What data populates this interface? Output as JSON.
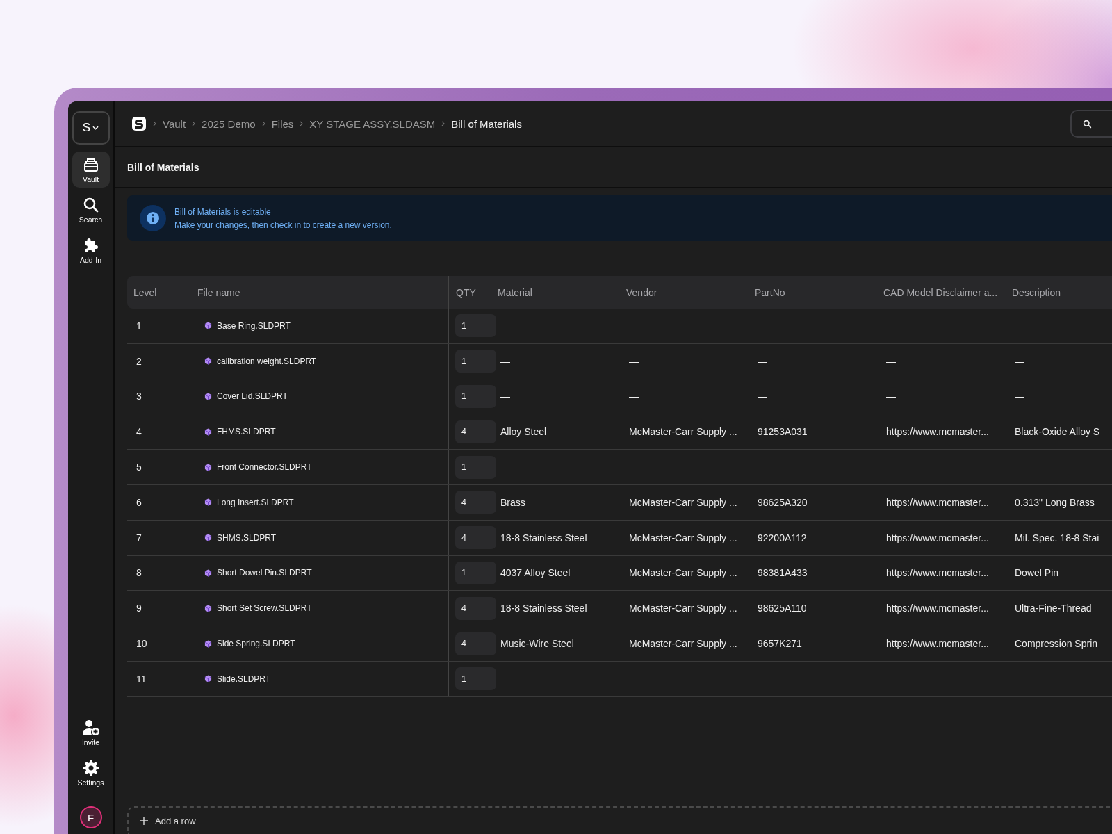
{
  "sidebar": {
    "workspace_button": "S",
    "nav": [
      {
        "label": "Vault",
        "selected": true
      },
      {
        "label": "Search",
        "selected": false
      },
      {
        "label": "Add-In",
        "selected": false
      }
    ],
    "bottom": [
      {
        "label": "Invite"
      },
      {
        "label": "Settings"
      }
    ],
    "avatar": "F"
  },
  "breadcrumb": [
    "Vault",
    "2025 Demo",
    "Files",
    "XY STAGE ASSY.SLDASM",
    "Bill of Materials"
  ],
  "page_title": "Bill of Materials",
  "banner": {
    "title": "Bill of Materials is editable",
    "text": "Make your changes, then check in to create a new version."
  },
  "table": {
    "columns": [
      "Level",
      "File name",
      "QTY",
      "Material",
      "Vendor",
      "PartNo",
      "CAD Model Disclaimer a...",
      "Description"
    ],
    "rows": [
      {
        "level": "1",
        "file_name": "Base Ring.SLDPRT",
        "qty": "1",
        "material": "—",
        "vendor": "—",
        "part_no": "—",
        "cad_model": "—",
        "description": "—"
      },
      {
        "level": "2",
        "file_name": "calibration weight.SLDPRT",
        "qty": "1",
        "material": "—",
        "vendor": "—",
        "part_no": "—",
        "cad_model": "—",
        "description": "—"
      },
      {
        "level": "3",
        "file_name": "Cover Lid.SLDPRT",
        "qty": "1",
        "material": "—",
        "vendor": "—",
        "part_no": "—",
        "cad_model": "—",
        "description": "—"
      },
      {
        "level": "4",
        "file_name": "FHMS.SLDPRT",
        "qty": "4",
        "material": "Alloy Steel",
        "vendor": "McMaster-Carr Supply ...",
        "part_no": "91253A031",
        "cad_model": "https://www.mcmaster...",
        "description": "Black-Oxide Alloy S"
      },
      {
        "level": "5",
        "file_name": "Front Connector.SLDPRT",
        "qty": "1",
        "material": "—",
        "vendor": "—",
        "part_no": "—",
        "cad_model": "—",
        "description": "—"
      },
      {
        "level": "6",
        "file_name": "Long Insert.SLDPRT",
        "qty": "4",
        "material": "Brass",
        "vendor": "McMaster-Carr Supply ...",
        "part_no": "98625A320",
        "cad_model": "https://www.mcmaster...",
        "description": "0.313\" Long Brass"
      },
      {
        "level": "7",
        "file_name": "SHMS.SLDPRT",
        "qty": "4",
        "material": "18-8 Stainless Steel",
        "vendor": "McMaster-Carr Supply ...",
        "part_no": "92200A112",
        "cad_model": "https://www.mcmaster...",
        "description": "Mil. Spec. 18-8 Stai"
      },
      {
        "level": "8",
        "file_name": "Short Dowel Pin.SLDPRT",
        "qty": "1",
        "material": "4037 Alloy Steel",
        "vendor": "McMaster-Carr Supply ...",
        "part_no": "98381A433",
        "cad_model": "https://www.mcmaster...",
        "description": "Dowel Pin"
      },
      {
        "level": "9",
        "file_name": "Short Set Screw.SLDPRT",
        "qty": "4",
        "material": "18-8 Stainless Steel",
        "vendor": "McMaster-Carr Supply ...",
        "part_no": "98625A110",
        "cad_model": "https://www.mcmaster...",
        "description": "Ultra-Fine-Thread"
      },
      {
        "level": "10",
        "file_name": "Side Spring.SLDPRT",
        "qty": "4",
        "material": "Music-Wire Steel",
        "vendor": "McMaster-Carr Supply ...",
        "part_no": "9657K271",
        "cad_model": "https://www.mcmaster...",
        "description": "Compression Sprin"
      },
      {
        "level": "11",
        "file_name": "Slide.SLDPRT",
        "qty": "1",
        "material": "—",
        "vendor": "—",
        "part_no": "—",
        "cad_model": "—",
        "description": "—"
      }
    ]
  },
  "add_row": "Add a row"
}
